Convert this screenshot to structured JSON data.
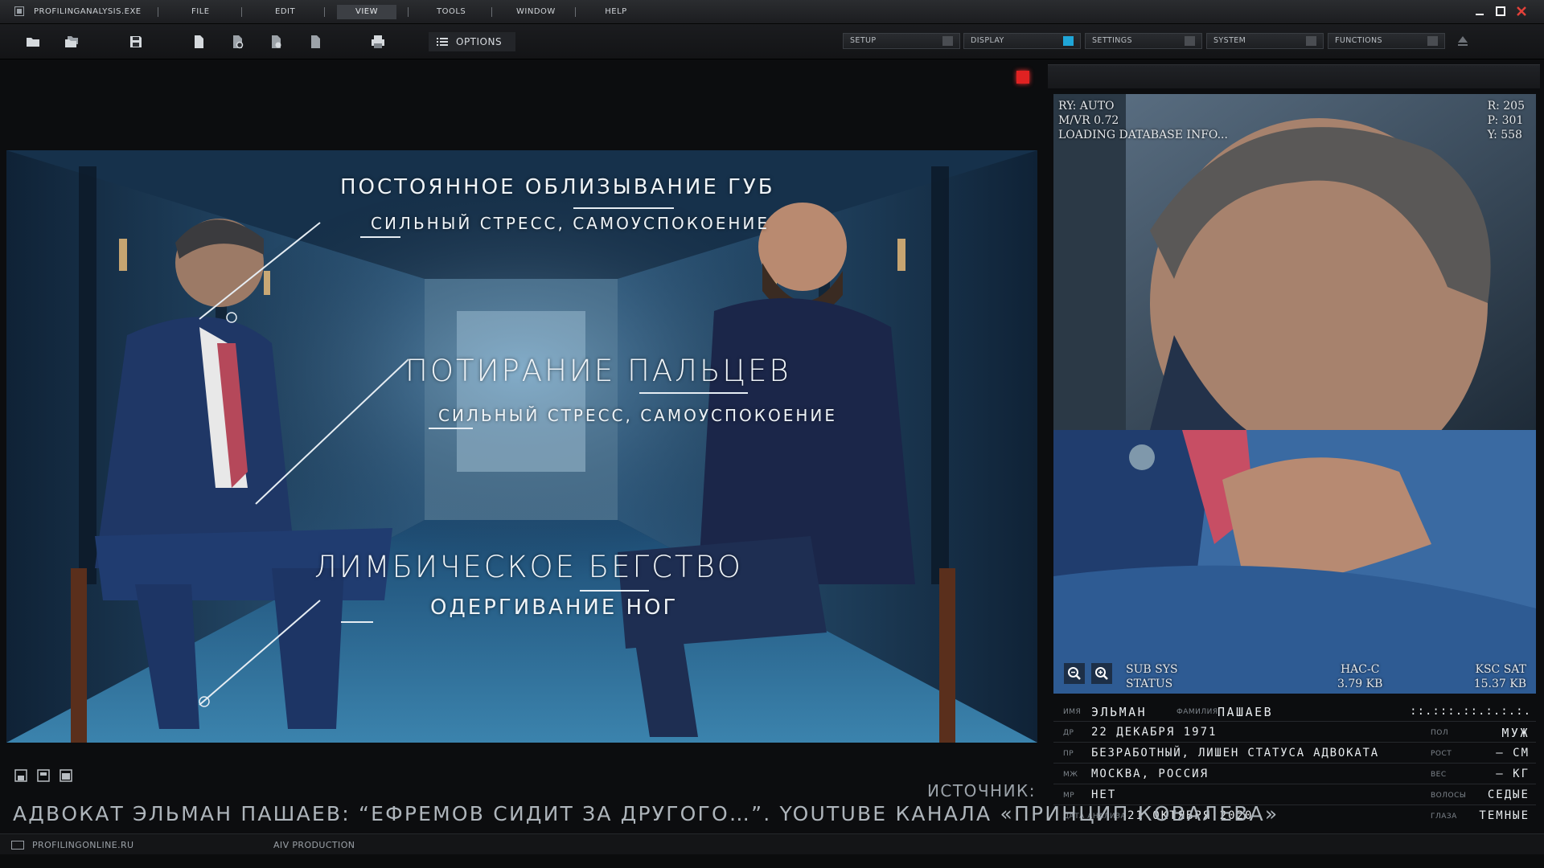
{
  "app": {
    "title": "PROFILINGANALYSIS.EXE"
  },
  "menu": [
    "FILE",
    "EDIT",
    "VIEW",
    "TOOLS",
    "WINDOW",
    "HELP"
  ],
  "menu_active": "VIEW",
  "toolbar": {
    "options_label": "OPTIONS",
    "panels": [
      {
        "label": "SETUP",
        "on": false
      },
      {
        "label": "DISPLAY",
        "on": true
      },
      {
        "label": "SETTINGS",
        "on": false
      },
      {
        "label": "SYSTEM",
        "on": false
      },
      {
        "label": "FUNCTIONS",
        "on": false
      }
    ],
    "icons": [
      "folder-icon",
      "folders-icon",
      "save-icon",
      "document-icon",
      "document-gear-icon",
      "document-add-icon",
      "document-copy-icon",
      "print-icon"
    ]
  },
  "video": {
    "overlays": {
      "o1_title": "ПОСТОЯННОЕ ОБЛИЗЫВАНИЕ ГУБ",
      "o1_sub": "СИЛЬНЫЙ СТРЕСС, САМОУСПОКОЕНИЕ",
      "o2_title": "ПОТИРАНИЕ ПАЛЬЦЕВ",
      "o2_sub": "СИЛЬНЫЙ СТРЕСС, САМОУСПОКОЕНИЕ",
      "o3_title": "ЛИМБИЧЕСКОЕ БЕГСТВО",
      "o3_sub": "ОДЕРГИВАНИЕ НОГ"
    }
  },
  "zoom": {
    "hud_left": [
      "RY: AUTO",
      "M/VR 0.72",
      "LOADING DATABASE INFO..."
    ],
    "hud_right": [
      "R: 205",
      "P: 301",
      "Y: 558"
    ],
    "subsys": [
      "SUB SYS",
      "STATUS"
    ],
    "hac": [
      "HAC-C",
      "3.79 KB"
    ],
    "ksc": [
      "KSC SAT",
      "15.37 KB"
    ]
  },
  "info": {
    "name_label": "ИМЯ",
    "name": "ЭЛЬМАН",
    "surname_label": "ФАМИЛИЯ",
    "surname": "ПАШАЕВ",
    "code": "::.:::.::.:.:.:.",
    "dob_label": "ДР",
    "dob": "22 ДЕКАБРЯ 1971",
    "sex_label": "ПОЛ",
    "sex": "МУЖ",
    "prof_label": "ПР",
    "prof": "БЕЗРАБОТНЫЙ, ЛИШЕН СТАТУСА АДВОКАТА",
    "height_label": "РОСТ",
    "height": "– СМ",
    "city_label": "МЖ",
    "city": "МОСКВА, РОССИЯ",
    "weight_label": "ВЕС",
    "weight": "– КГ",
    "mp_label": "МР",
    "mp": "НЕТ",
    "hair_label": "ВОЛОСЫ",
    "hair": "СЕДЫЕ",
    "date_label": "ДАТА АНАЛИЗА",
    "date": "21 ОКТЯБРЯ 2020",
    "eyes_label": "ГЛАЗА",
    "eyes": "ТЕМНЫЕ"
  },
  "footer": {
    "source_label": "ИСТОЧНИК:",
    "caption": "АДВОКАТ ЭЛЬМАН ПАШАЕВ: “ЕФРЕМОВ СИДИТ ЗА ДРУГОГО…”. YOUTUBE КАНАЛА «ПРИНЦИП КОВАЛЕВА»",
    "site": "PROFILINGONLINE.RU",
    "production": "AIV PRODUCTION"
  }
}
